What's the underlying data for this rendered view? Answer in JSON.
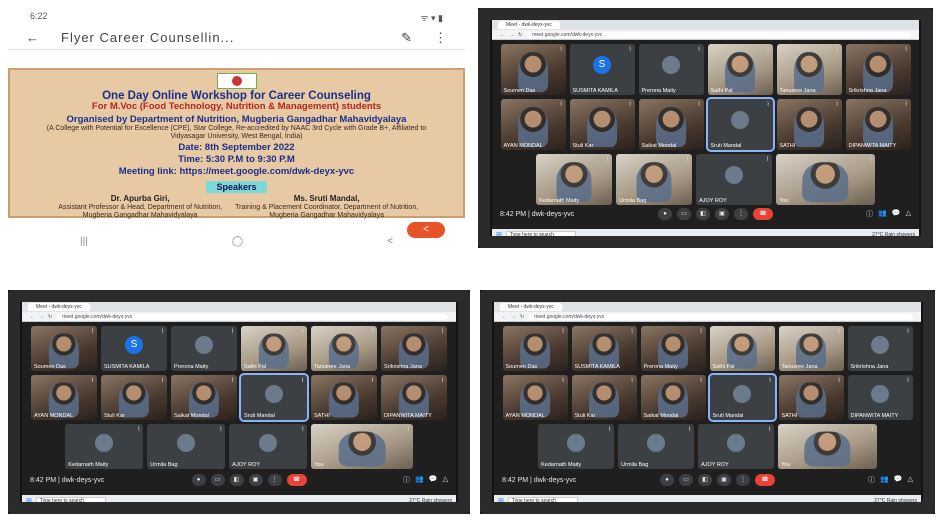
{
  "phone": {
    "status_time": "6:22",
    "status_right": "ᯤ ▾ ▮",
    "app_title": "Flyer Career Counsellin...",
    "flyer": {
      "heading": "One Day Online Workshop for Career Counseling",
      "subheading": "For M.Voc (Food Technology, Nutrition & Management) students",
      "organiser": "Organised by Department of Nutrition, Mugberia Gangadhar Mahavidyalaya",
      "organiser_note": "(A College with Potential for Excellence (CPE), Star College, Re-accredited by NAAC 3rd Cycle with Grade B+, Affiliated to Vidyasagar University, West Bengal, India)",
      "date": "Date: 8th September 2022",
      "time": "Time: 5:30 P.M to 9:30 P.M",
      "meeting_link": "Meeting link: https://meet.google.com/dwk-deyx-yvc",
      "speakers_label": "Speakers",
      "speaker1_name": "Dr. Apurba Giri,",
      "speaker1_detail": "Assistant Professor & Head, Department of Nutrition, Mugberia Gangadhar Mahavidyalaya",
      "speaker2_name": "Ms. Sruti Mandal,",
      "speaker2_detail": "Training & Placement Coordinator, Department of Nutrition, Mugberia Gangadhar Mahavidyalaya"
    },
    "share_icon": "share-icon",
    "nav": [
      "|||",
      "◯",
      "<"
    ]
  },
  "meetings": [
    {
      "tab_title": "Meet - dwk-deyx-yvc",
      "url": "meet.google.com/dwk-deyx-yvc",
      "rows": [
        [
          {
            "name": "Soumen Das",
            "kind": "video"
          },
          {
            "name": "SUSMITA KAMILA",
            "kind": "avatar",
            "initial": "S"
          },
          {
            "name": "Prerona Maity",
            "kind": "avatar-photo"
          },
          {
            "name": "Sathi Pal",
            "kind": "video-light"
          },
          {
            "name": "Tanusree Jana",
            "kind": "video-light"
          },
          {
            "name": "Srikrishna Jana",
            "kind": "video"
          }
        ],
        [
          {
            "name": "AYAN MONDAL",
            "kind": "video"
          },
          {
            "name": "Stuli Kar",
            "kind": "video"
          },
          {
            "name": "Saikat Mondal",
            "kind": "video"
          },
          {
            "name": "Sruti Mandal",
            "kind": "avatar-photo",
            "active": true
          },
          {
            "name": "SATHI",
            "kind": "video"
          },
          {
            "name": "DIPANWITA MAITY",
            "kind": "video"
          }
        ],
        [
          {
            "name": "Kedarnath Maity",
            "kind": "video-light"
          },
          {
            "name": "Urmila Bag",
            "kind": "video-light"
          },
          {
            "name": "AJOY ROY",
            "kind": "avatar-photo"
          },
          {
            "name": "You",
            "kind": "video-light"
          }
        ]
      ],
      "time": "8:42 PM",
      "code": "dwk-deys-yvc",
      "taskbar_search": "Type here to search",
      "weather": "27°C Rain showers"
    },
    {
      "tab_title": "Meet - dwk-deyx-yvc",
      "url": "meet.google.com/dwk-deyx-yvc",
      "rows": [
        [
          {
            "name": "Soumen Das",
            "kind": "video"
          },
          {
            "name": "SUSMITA KAMILA",
            "kind": "avatar",
            "initial": "S"
          },
          {
            "name": "Prerona Maity",
            "kind": "avatar-photo"
          },
          {
            "name": "Sathi Pal",
            "kind": "video-light"
          },
          {
            "name": "Tanusree Jana",
            "kind": "video-light"
          },
          {
            "name": "Srikrishna Jana",
            "kind": "video"
          }
        ],
        [
          {
            "name": "AYAN MONDAL",
            "kind": "video"
          },
          {
            "name": "Stuli Kar",
            "kind": "video"
          },
          {
            "name": "Saikat Mondal",
            "kind": "video"
          },
          {
            "name": "Sruti Mandal",
            "kind": "avatar-photo",
            "active": true
          },
          {
            "name": "SATHI",
            "kind": "video"
          },
          {
            "name": "DIPANWITA MAITY",
            "kind": "video"
          }
        ],
        [
          {
            "name": "Kedarnath Maity",
            "kind": "avatar-photo"
          },
          {
            "name": "Urmila Bag",
            "kind": "avatar-photo"
          },
          {
            "name": "AJOY ROY",
            "kind": "avatar-photo"
          },
          {
            "name": "You",
            "kind": "video-light"
          }
        ]
      ],
      "time": "8:42 PM",
      "code": "dwk-deys-yvc",
      "taskbar_search": "Type here to search",
      "weather": "27°C Rain showers"
    },
    {
      "tab_title": "Meet - dwk-deyx-yvc",
      "url": "meet.google.com/dwk-deyx-yvc",
      "rows": [
        [
          {
            "name": "Soumen Das",
            "kind": "video"
          },
          {
            "name": "SUSMITA KAMILA",
            "kind": "video"
          },
          {
            "name": "Prerona Maity",
            "kind": "video"
          },
          {
            "name": "Sathi Pal",
            "kind": "video-light"
          },
          {
            "name": "Tanusree Jana",
            "kind": "video-light"
          },
          {
            "name": "Srikrishna Jana",
            "kind": "avatar-photo"
          }
        ],
        [
          {
            "name": "AYAN MONDAL",
            "kind": "video"
          },
          {
            "name": "Stuli Kar",
            "kind": "video"
          },
          {
            "name": "Saikat Mondal",
            "kind": "video"
          },
          {
            "name": "Sruti Mandal",
            "kind": "avatar-photo",
            "active": true
          },
          {
            "name": "SATHI",
            "kind": "video"
          },
          {
            "name": "DIPANWITA MAITY",
            "kind": "avatar-photo"
          }
        ],
        [
          {
            "name": "Kedarnath Maity",
            "kind": "avatar-photo"
          },
          {
            "name": "Urmila Bag",
            "kind": "avatar-photo"
          },
          {
            "name": "AJOY ROY",
            "kind": "avatar-photo"
          },
          {
            "name": "You",
            "kind": "video-light"
          }
        ]
      ],
      "time": "8:42 PM",
      "code": "dwk-deys-yvc",
      "taskbar_search": "Type here to search",
      "weather": "27°C Rain showers"
    }
  ],
  "controls": [
    "mic-icon",
    "camera-icon",
    "captions-icon",
    "present-icon",
    "more-icon",
    "end-call-icon"
  ],
  "control_glyphs": [
    "●",
    "▭",
    "◧",
    "▣",
    "⋮",
    "☎"
  ],
  "side_icons": [
    "ⓘ",
    "👥",
    "💬",
    "△"
  ]
}
